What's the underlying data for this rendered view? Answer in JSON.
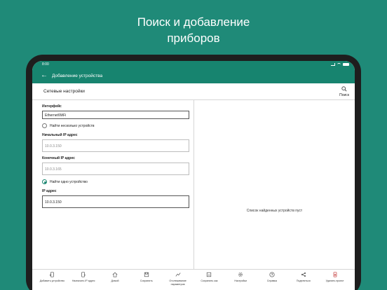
{
  "promo": {
    "line1": "Поиск и добавление",
    "line2": "приборов"
  },
  "status": {
    "time": "8:00"
  },
  "appbar": {
    "title": "Добавление устройства"
  },
  "section": {
    "title": "Сетевые настройки",
    "search_label": "Поиск"
  },
  "form": {
    "interface_label": "Интерфейс",
    "interface_value": "Ethernet/WiFi",
    "multi_radio": "Найти несколько устройств",
    "start_ip_label": "Начальный IP адрес",
    "start_ip_placeholder": "10.0.3.150",
    "end_ip_label": "Конечный IP адрес",
    "end_ip_placeholder": "10.0.3.165",
    "single_radio": "Найти одно устройство",
    "ip_label": "IP адрес",
    "ip_value": "10.0.3.150"
  },
  "results": {
    "empty": "Список найденных устройств пуст"
  },
  "toolbar": [
    {
      "label": "Добавить устройство",
      "icon": "device-add-icon"
    },
    {
      "label": "Назначить IP адрес",
      "icon": "assign-ip-icon"
    },
    {
      "label": "Домой",
      "icon": "home-icon"
    },
    {
      "label": "Сохранить",
      "icon": "save-icon"
    },
    {
      "label": "Отслеживание параметров",
      "icon": "tracking-icon"
    },
    {
      "label": "Сохранить как",
      "icon": "save-as-icon"
    },
    {
      "label": "Настройки",
      "icon": "gear-icon"
    },
    {
      "label": "Справка",
      "icon": "help-icon"
    },
    {
      "label": "Поделиться",
      "icon": "share-icon"
    },
    {
      "label": "Удалить проект",
      "icon": "delete-project-icon"
    }
  ],
  "colors": {
    "brand": "#1f8a78",
    "appbar": "#17846f"
  }
}
